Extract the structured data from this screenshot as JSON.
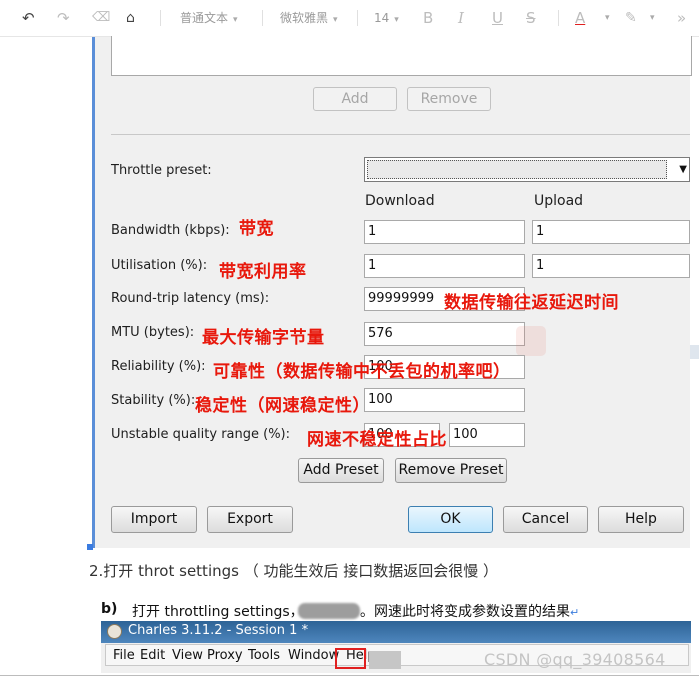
{
  "toolbar": {
    "undo": "↶",
    "redo": "↷",
    "eraser": "⌫",
    "format_painter": "⌂",
    "paragraph_style": "普通文本",
    "font_family": "微软雅黑",
    "font_size": "14",
    "bold": "B",
    "italic": "I",
    "underline": "U",
    "strike": "S",
    "font_color": "A",
    "highlight": "✎",
    "more": "»"
  },
  "dialog": {
    "add_label": "Add",
    "remove_label": "Remove",
    "throttle_preset_label": "Throttle preset:",
    "download_header": "Download",
    "upload_header": "Upload",
    "rows": [
      {
        "label": "Bandwidth (kbps):",
        "download": "1",
        "upload": "1",
        "annotation": "带宽"
      },
      {
        "label": "Utilisation (%):",
        "download": "1",
        "upload": "1",
        "annotation": "带宽利用率"
      },
      {
        "label": "Round-trip latency (ms):",
        "download": "99999999",
        "annotation": "数据传输往返延迟时间"
      },
      {
        "label": "MTU (bytes):",
        "download": "576",
        "annotation": "最大传输字节量"
      },
      {
        "label": "Reliability (%):",
        "download": "100",
        "annotation": "可靠性（数据传输中不丢包的机率吧）"
      },
      {
        "label": "Stability (%):",
        "download": "100",
        "annotation": "稳定性（网速稳定性）"
      },
      {
        "label": "Unstable quality range (%):",
        "download": "100",
        "upload": "100",
        "annotation": "网速不稳定性占比"
      }
    ],
    "add_preset_label": "Add Preset",
    "remove_preset_label": "Remove Preset",
    "import_label": "Import",
    "export_label": "Export",
    "ok_label": "OK",
    "cancel_label": "Cancel",
    "help_label": "Help"
  },
  "doc": {
    "step2": "2.打开 throt settings （ 功能生效后 接口数据返回会很慢 ）",
    "step_b_prefix": "b)",
    "step_b_text_1": "打开  throttling settings，",
    "step_b_text_2": "。网速此时将变成参数设置的结果",
    "edit_mark": "↵"
  },
  "embedded_screenshot": {
    "title": "Charles 3.11.2 - Session 1 *",
    "menus": [
      "File",
      "Edit",
      "View",
      "Proxy",
      "Tools",
      "Window",
      "Help"
    ]
  },
  "watermark": "CSDN @qq_39408564",
  "colors": {
    "annotation": "#e8180c",
    "title_bar": "#2d6396"
  }
}
